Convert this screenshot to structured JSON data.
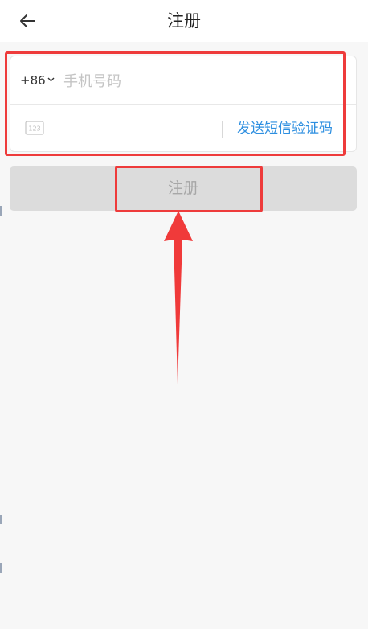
{
  "header": {
    "title": "注册",
    "back_icon": "arrow-left-icon"
  },
  "form": {
    "country_code": "+86",
    "country_chevron_icon": "chevron-down-icon",
    "phone_placeholder": "手机号码",
    "phone_value": "",
    "code_icon": "keypad-123-icon",
    "code_value": "",
    "send_code_label": "发送短信验证码"
  },
  "register_button": {
    "label": "注册",
    "state": "disabled"
  },
  "colors": {
    "background": "#f7f7f7",
    "link": "#2e8fe0",
    "button_disabled_bg": "#dcdcdc",
    "button_disabled_text": "#a7a7a7",
    "annotation": "#ee3b3b"
  }
}
